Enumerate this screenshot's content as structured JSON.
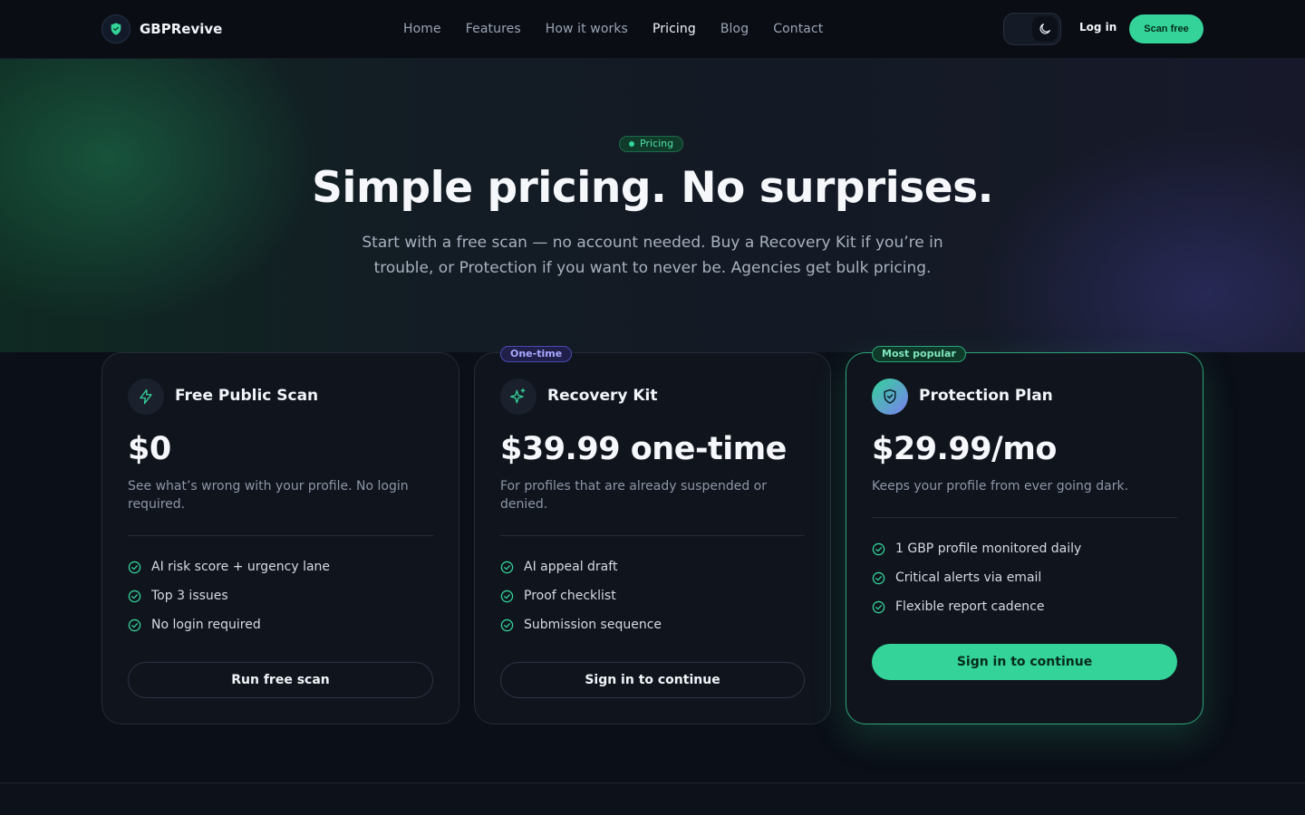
{
  "brand": {
    "name": "GBPRevive"
  },
  "nav": {
    "items": [
      "Home",
      "Features",
      "How it works",
      "Pricing",
      "Blog",
      "Contact"
    ],
    "active": "Pricing"
  },
  "header": {
    "login_label": "Log in",
    "scan_label": "Scan free"
  },
  "hero": {
    "pill": "Pricing",
    "title": "Simple pricing. No surprises.",
    "subtitle": "Start with a free scan — no account needed. Buy a Recovery Kit if you’re in trouble, or Protection if you want to never be. Agencies get bulk pricing."
  },
  "plans": [
    {
      "tag": "",
      "icon": "bolt-icon",
      "name": "Free Public Scan",
      "price": "$0",
      "description": "See what’s wrong with your profile. No login required.",
      "features": [
        "AI risk score + urgency lane",
        "Top 3 issues",
        "No login required"
      ],
      "cta": "Run free scan"
    },
    {
      "tag": "One-time",
      "icon": "sparkles-icon",
      "name": "Recovery Kit",
      "price": "$39.99 one-time",
      "description": "For profiles that are already suspended or denied.",
      "features": [
        "AI appeal draft",
        "Proof checklist",
        "Submission sequence"
      ],
      "cta": "Sign in to continue"
    },
    {
      "tag": "Most popular",
      "icon": "shield-check-icon",
      "name": "Protection Plan",
      "price": "$29.99/mo",
      "description": "Keeps your profile from ever going dark.",
      "features": [
        "1 GBP profile monitored daily",
        "Critical alerts via email",
        "Flexible report cadence"
      ],
      "cta": "Sign in to continue"
    }
  ],
  "colors": {
    "accent": "#34d399",
    "background": "#0b0f17",
    "card": "#10141d",
    "tag_purple": "#a8a8ff"
  }
}
